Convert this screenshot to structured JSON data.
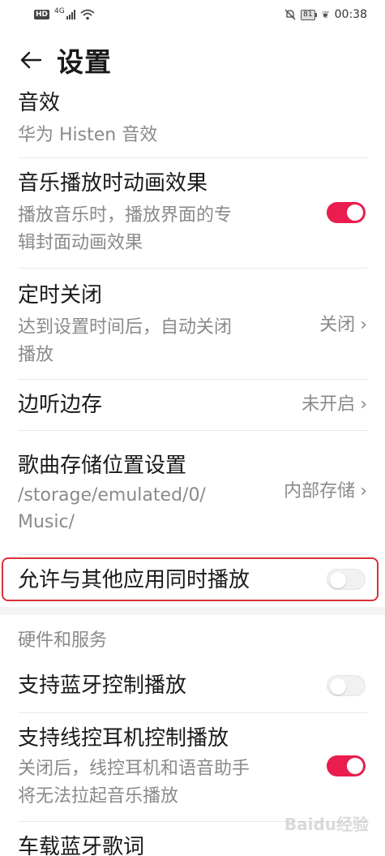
{
  "status_bar": {
    "hd": "HD",
    "network": "4G",
    "battery": "81",
    "time": "00:38"
  },
  "header": {
    "title": "设置"
  },
  "items": [
    {
      "title": "音效",
      "subtitle": "华为 Histen 音效"
    },
    {
      "title": "音乐播放时动画效果",
      "subtitle_lines": [
        "播放音乐时，播放界面的专",
        "辑封面动画效果"
      ],
      "toggle": "on"
    },
    {
      "title": "定时关闭",
      "subtitle_lines": [
        "达到设置时间后，自动关闭",
        "播放"
      ],
      "value": "关闭"
    },
    {
      "title": "边听边存",
      "value": "未开启"
    },
    {
      "title": "歌曲存储位置设置",
      "subtitle_lines": [
        "/storage/emulated/0/",
        "Music/"
      ],
      "value": "内部存储"
    },
    {
      "title": "允许与其他应用同时播放",
      "toggle": "off"
    }
  ],
  "section": {
    "title": "硬件和服务"
  },
  "hardware_items": [
    {
      "title": "支持蓝牙控制播放",
      "toggle": "off"
    },
    {
      "title": "支持线控耳机控制播放",
      "subtitle_lines": [
        "关闭后，线控耳机和语音助手",
        "将无法拉起音乐播放"
      ],
      "toggle": "on"
    },
    {
      "title": "车载蓝牙歌词"
    }
  ],
  "colors": {
    "accent": "#e91e4e",
    "highlight_border": "#d9313a"
  },
  "watermark": "Baidu经验"
}
